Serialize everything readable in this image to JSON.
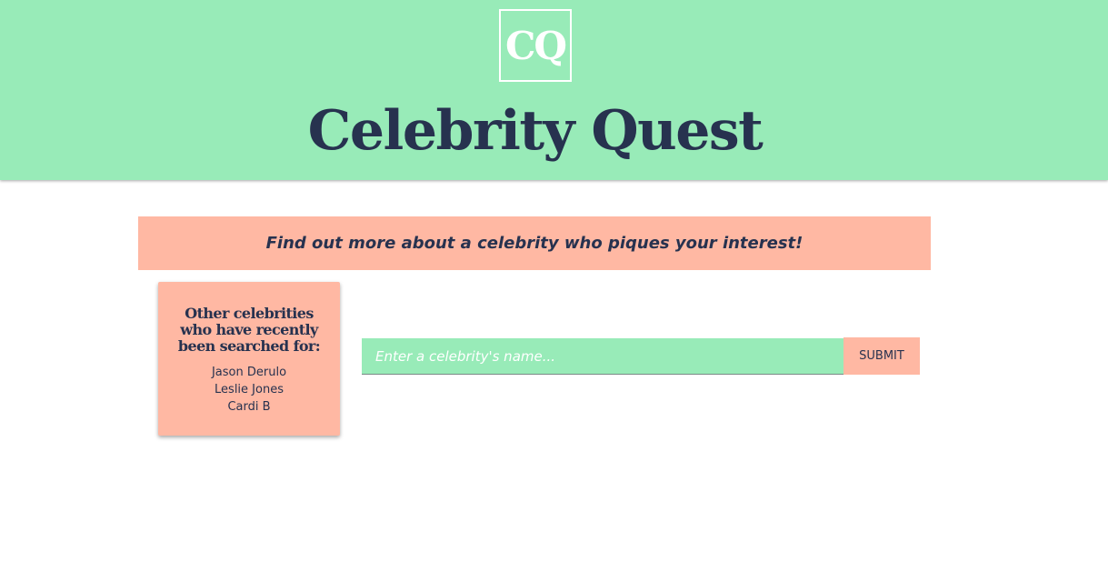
{
  "header": {
    "logo_text": "CQ",
    "title": "Celebrity Quest"
  },
  "banner": {
    "text": "Find out more about a celebrity who piques your interest!"
  },
  "recent": {
    "heading": "Other celebrities who have recently been searched for:",
    "items": [
      "Jason Derulo",
      "Leslie Jones",
      "Cardi B"
    ]
  },
  "search": {
    "placeholder": "Enter a celebrity's name...",
    "value": "",
    "submit_label": "SUBMIT"
  },
  "colors": {
    "header_bg": "#98ebb8",
    "accent_peach": "#ffb8a3",
    "text_navy": "#27324f",
    "background": "#ffffff"
  }
}
